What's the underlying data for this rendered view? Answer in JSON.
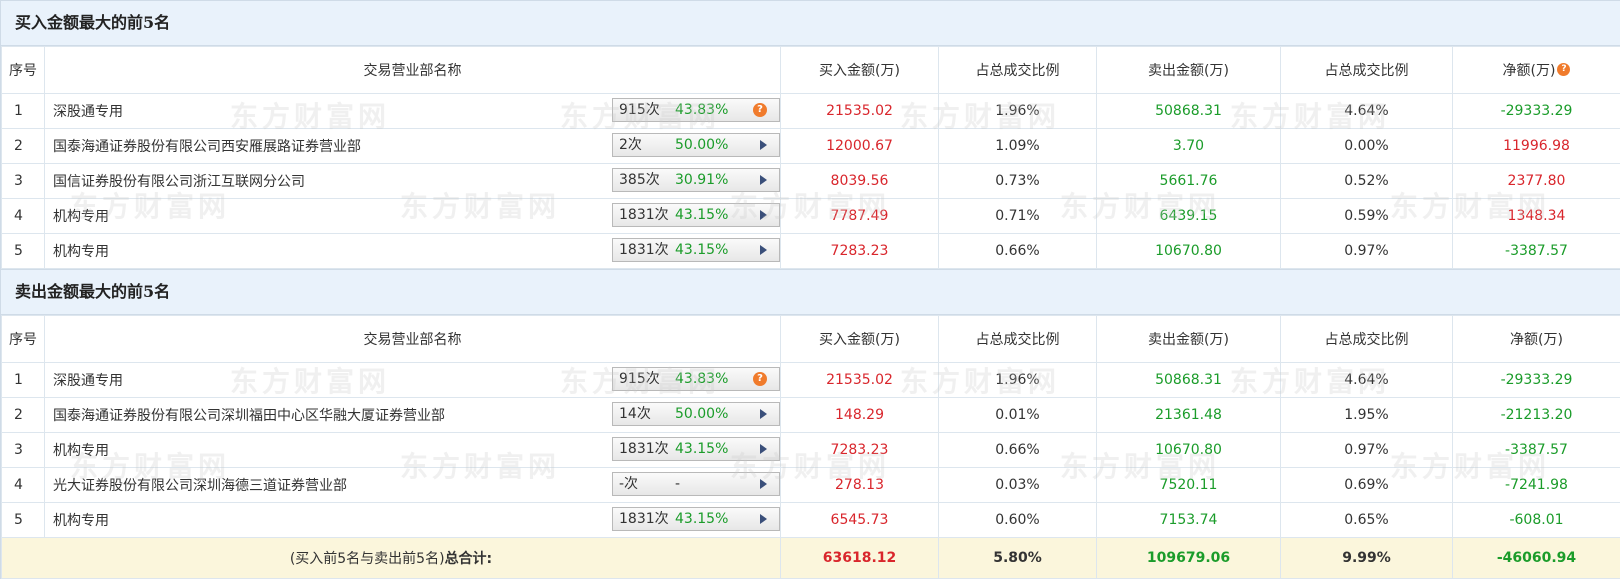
{
  "buy_section": {
    "title": "买入金额最大的前5名",
    "headers": {
      "idx": "序号",
      "name": "交易营业部名称",
      "buy": "买入金额(万)",
      "buy_ratio": "占总成交比例",
      "sell": "卖出金额(万)",
      "sell_ratio": "占总成交比例",
      "net": "净额(万)"
    },
    "header_help_icon": "?",
    "rows": [
      {
        "idx": "1",
        "name": "深股通专用",
        "times": "915次",
        "win_rate": "43.83%",
        "icon": "help-icon",
        "buy": "21535.02",
        "buy_ratio": "1.96%",
        "sell": "50868.31",
        "sell_ratio": "4.64%",
        "net": "-29333.29",
        "net_color": "green"
      },
      {
        "idx": "2",
        "name": "国泰海通证券股份有限公司西安雁展路证券营业部",
        "times": "2次",
        "win_rate": "50.00%",
        "icon": "play-icon",
        "buy": "12000.67",
        "buy_ratio": "1.09%",
        "sell": "3.70",
        "sell_ratio": "0.00%",
        "net": "11996.98",
        "net_color": "red"
      },
      {
        "idx": "3",
        "name": "国信证券股份有限公司浙江互联网分公司",
        "times": "385次",
        "win_rate": "30.91%",
        "icon": "play-icon",
        "buy": "8039.56",
        "buy_ratio": "0.73%",
        "sell": "5661.76",
        "sell_ratio": "0.52%",
        "net": "2377.80",
        "net_color": "red"
      },
      {
        "idx": "4",
        "name": "机构专用",
        "times": "1831次",
        "win_rate": "43.15%",
        "icon": "play-icon",
        "buy": "7787.49",
        "buy_ratio": "0.71%",
        "sell": "6439.15",
        "sell_ratio": "0.59%",
        "net": "1348.34",
        "net_color": "red"
      },
      {
        "idx": "5",
        "name": "机构专用",
        "times": "1831次",
        "win_rate": "43.15%",
        "icon": "play-icon",
        "buy": "7283.23",
        "buy_ratio": "0.66%",
        "sell": "10670.80",
        "sell_ratio": "0.97%",
        "net": "-3387.57",
        "net_color": "green"
      }
    ]
  },
  "sell_section": {
    "title": "卖出金额最大的前5名",
    "headers": {
      "idx": "序号",
      "name": "交易营业部名称",
      "buy": "买入金额(万)",
      "buy_ratio": "占总成交比例",
      "sell": "卖出金额(万)",
      "sell_ratio": "占总成交比例",
      "net": "净额(万)"
    },
    "rows": [
      {
        "idx": "1",
        "name": "深股通专用",
        "times": "915次",
        "win_rate": "43.83%",
        "icon": "help-icon",
        "buy": "21535.02",
        "buy_ratio": "1.96%",
        "sell": "50868.31",
        "sell_ratio": "4.64%",
        "net": "-29333.29",
        "net_color": "green"
      },
      {
        "idx": "2",
        "name": "国泰海通证券股份有限公司深圳福田中心区华融大厦证券营业部",
        "times": "14次",
        "win_rate": "50.00%",
        "icon": "play-icon",
        "buy": "148.29",
        "buy_ratio": "0.01%",
        "sell": "21361.48",
        "sell_ratio": "1.95%",
        "net": "-21213.20",
        "net_color": "green"
      },
      {
        "idx": "3",
        "name": "机构专用",
        "times": "1831次",
        "win_rate": "43.15%",
        "icon": "play-icon",
        "buy": "7283.23",
        "buy_ratio": "0.66%",
        "sell": "10670.80",
        "sell_ratio": "0.97%",
        "net": "-3387.57",
        "net_color": "green"
      },
      {
        "idx": "4",
        "name": "光大证券股份有限公司深圳海德三道证券营业部",
        "times": "-次",
        "win_rate": "-",
        "icon": "play-icon",
        "buy": "278.13",
        "buy_ratio": "0.03%",
        "sell": "7520.11",
        "sell_ratio": "0.69%",
        "net": "-7241.98",
        "net_color": "green"
      },
      {
        "idx": "5",
        "name": "机构专用",
        "times": "1831次",
        "win_rate": "43.15%",
        "icon": "play-icon",
        "buy": "6545.73",
        "buy_ratio": "0.60%",
        "sell": "7153.74",
        "sell_ratio": "0.65%",
        "net": "-608.01",
        "net_color": "green"
      }
    ],
    "total": {
      "label_prefix": "(买入前5名与卖出前5名)",
      "label_bold": "总合计:",
      "buy": "63618.12",
      "buy_ratio": "5.80%",
      "sell": "109679.06",
      "sell_ratio": "9.99%",
      "net": "-46060.94"
    }
  },
  "watermark_text": "东方财富网",
  "colors": {
    "red": "#d9262c",
    "green": "#1b9c2a",
    "header_bg": "#e9f2fb",
    "total_bg": "#fbf6dc"
  }
}
